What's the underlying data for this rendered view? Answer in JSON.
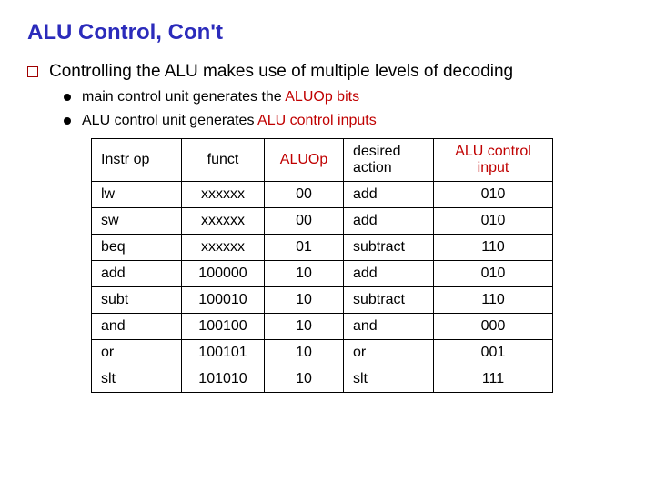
{
  "title": "ALU Control, Con't",
  "bullets": {
    "main": "Controlling the ALU makes use of multiple levels of decoding",
    "sub1_a": "main control unit generates the ",
    "sub1_b": "ALUOp bits",
    "sub2_a": "ALU control unit generates ",
    "sub2_b": "ALU control inputs"
  },
  "headers": {
    "instrop": "Instr op",
    "funct": "funct",
    "aluop": "ALUOp",
    "desired": "desired action",
    "aluctrl": "ALU control input"
  },
  "rows": [
    {
      "instrop": "lw",
      "funct": "xxxxxx",
      "aluop": "00",
      "desired": "add",
      "ctrl": "010"
    },
    {
      "instrop": "sw",
      "funct": "xxxxxx",
      "aluop": "00",
      "desired": "add",
      "ctrl": "010"
    },
    {
      "instrop": "beq",
      "funct": "xxxxxx",
      "aluop": "01",
      "desired": "subtract",
      "ctrl": "110"
    },
    {
      "instrop": "add",
      "funct": "100000",
      "aluop": "10",
      "desired": "add",
      "ctrl": "010"
    },
    {
      "instrop": "subt",
      "funct": "100010",
      "aluop": "10",
      "desired": "subtract",
      "ctrl": "110"
    },
    {
      "instrop": "and",
      "funct": "100100",
      "aluop": "10",
      "desired": "and",
      "ctrl": "000"
    },
    {
      "instrop": "or",
      "funct": "100101",
      "aluop": "10",
      "desired": "or",
      "ctrl": "001"
    },
    {
      "instrop": "slt",
      "funct": "101010",
      "aluop": "10",
      "desired": "slt",
      "ctrl": "111"
    }
  ],
  "chart_data": {
    "type": "table",
    "title": "ALU Control truth table",
    "columns": [
      "Instr op",
      "funct",
      "ALUOp",
      "desired action",
      "ALU control input"
    ],
    "rows": [
      [
        "lw",
        "xxxxxx",
        "00",
        "add",
        "010"
      ],
      [
        "sw",
        "xxxxxx",
        "00",
        "add",
        "010"
      ],
      [
        "beq",
        "xxxxxx",
        "01",
        "subtract",
        "110"
      ],
      [
        "add",
        "100000",
        "10",
        "add",
        "010"
      ],
      [
        "subt",
        "100010",
        "10",
        "subtract",
        "110"
      ],
      [
        "and",
        "100100",
        "10",
        "and",
        "000"
      ],
      [
        "or",
        "100101",
        "10",
        "or",
        "001"
      ],
      [
        "slt",
        "101010",
        "10",
        "slt",
        "111"
      ]
    ]
  }
}
